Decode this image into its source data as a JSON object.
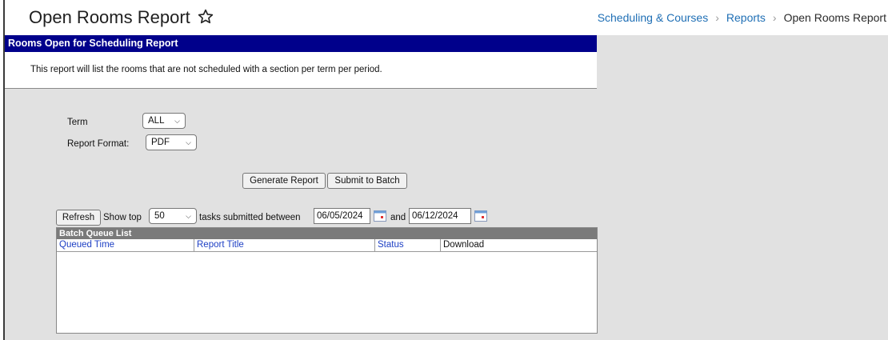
{
  "header": {
    "title": "Open Rooms Report",
    "breadcrumb": [
      "Scheduling & Courses",
      "Reports",
      "Open Rooms Report"
    ]
  },
  "report": {
    "title": "Rooms Open for Scheduling Report",
    "description": "This report will list the rooms that are not scheduled with a section per term per period."
  },
  "form": {
    "term_label": "Term",
    "term_value": "ALL",
    "format_label": "Report Format:",
    "format_value": "PDF",
    "generate_label": "Generate Report",
    "submit_batch_label": "Submit to Batch"
  },
  "batch_controls": {
    "refresh_label": "Refresh",
    "show_top_label": "Show top",
    "show_top_value": "50",
    "tasks_label": "tasks submitted between",
    "start_date": "06/05/2024",
    "and_label": "and",
    "end_date": "06/12/2024"
  },
  "batch_queue": {
    "title": "Batch Queue List",
    "columns": [
      "Queued Time",
      "Report Title",
      "Status",
      "Download"
    ]
  },
  "colors": {
    "title_bar": "#00008b",
    "link": "#1f6fb5",
    "sort_link": "#1d3fc4",
    "content_bg": "#e1e1e1"
  }
}
